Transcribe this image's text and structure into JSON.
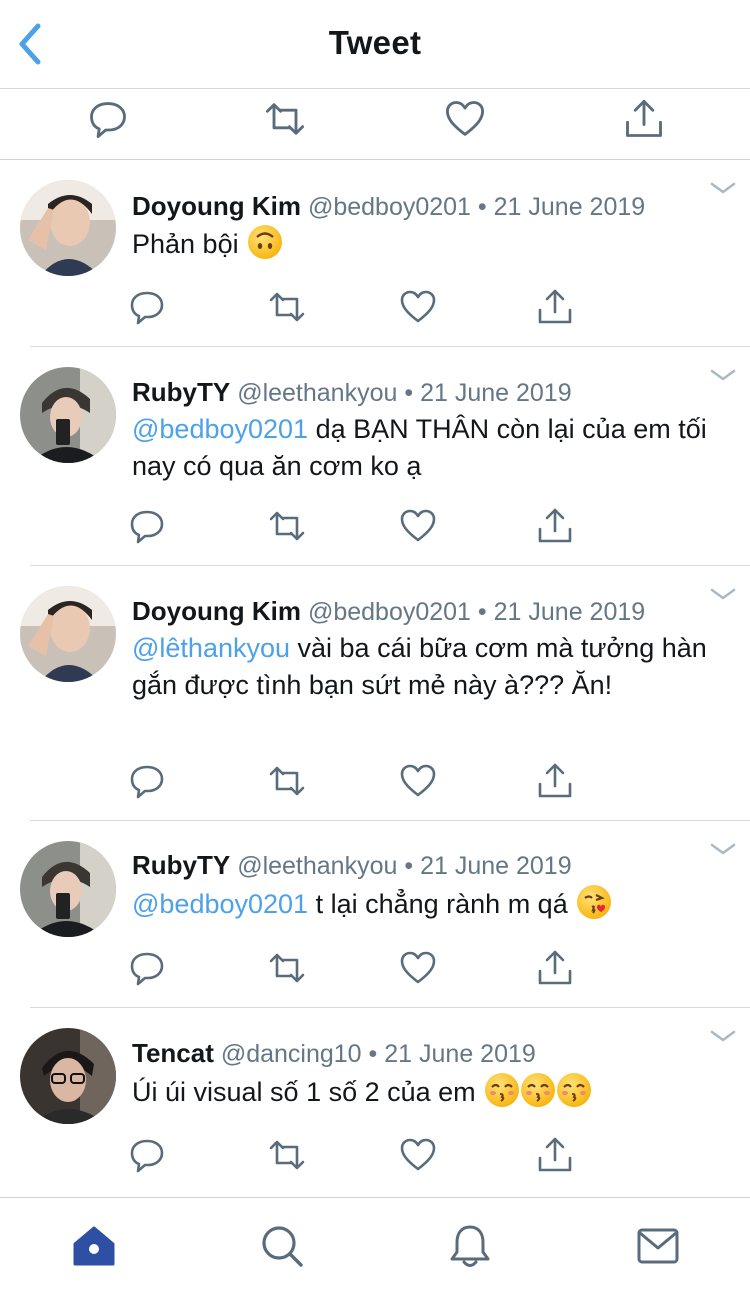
{
  "header": {
    "title": "Tweet",
    "back_icon": "chevron-left-icon"
  },
  "colors": {
    "accent": "#4da1e8",
    "icon": "#596c7c",
    "text": "#14171a",
    "muted": "#657786",
    "home_active": "#2e4fa3"
  },
  "replies": [
    {
      "name": "Doyoung Kim",
      "handle": "@bedboy0201",
      "dot": "•",
      "date": "21 June 2019",
      "text": "Phản bội",
      "emoji": "upside-down-face"
    },
    {
      "name": "RubyTY",
      "handle": "@leethankyou",
      "dot": "•",
      "date": "21 June 2019",
      "mention": "@bedboy0201",
      "text": " dạ BẠN THÂN còn lại của em tối nay có qua ăn cơm ko ạ"
    },
    {
      "name": "Doyoung Kim",
      "handle": "@bedboy0201",
      "dot": "•",
      "date": "21 June 2019",
      "mention": "@lêthankyou",
      "text": " vài ba cái bữa cơm mà tưởng hàn gắn được tình bạn sứt mẻ này à??? Ăn!"
    },
    {
      "name": "RubyTY",
      "handle": "@leethankyou",
      "dot": "•",
      "date": "21 June 2019",
      "mention": "@bedboy0201",
      "text": " t lại chẳng rành m qá",
      "emoji": "face-blowing-kiss"
    },
    {
      "name": "Tencat",
      "handle": "@dancing10",
      "dot": "•",
      "date": "21 June 2019",
      "text": "Úi úi visual số 1 số 2 của em",
      "emoji": "kissing-smiling-eyes x3"
    }
  ],
  "tabs": [
    {
      "name": "home",
      "icon": "home-icon",
      "active": true
    },
    {
      "name": "search",
      "icon": "search-icon"
    },
    {
      "name": "notifications",
      "icon": "bell-icon"
    },
    {
      "name": "messages",
      "icon": "mail-icon"
    }
  ]
}
